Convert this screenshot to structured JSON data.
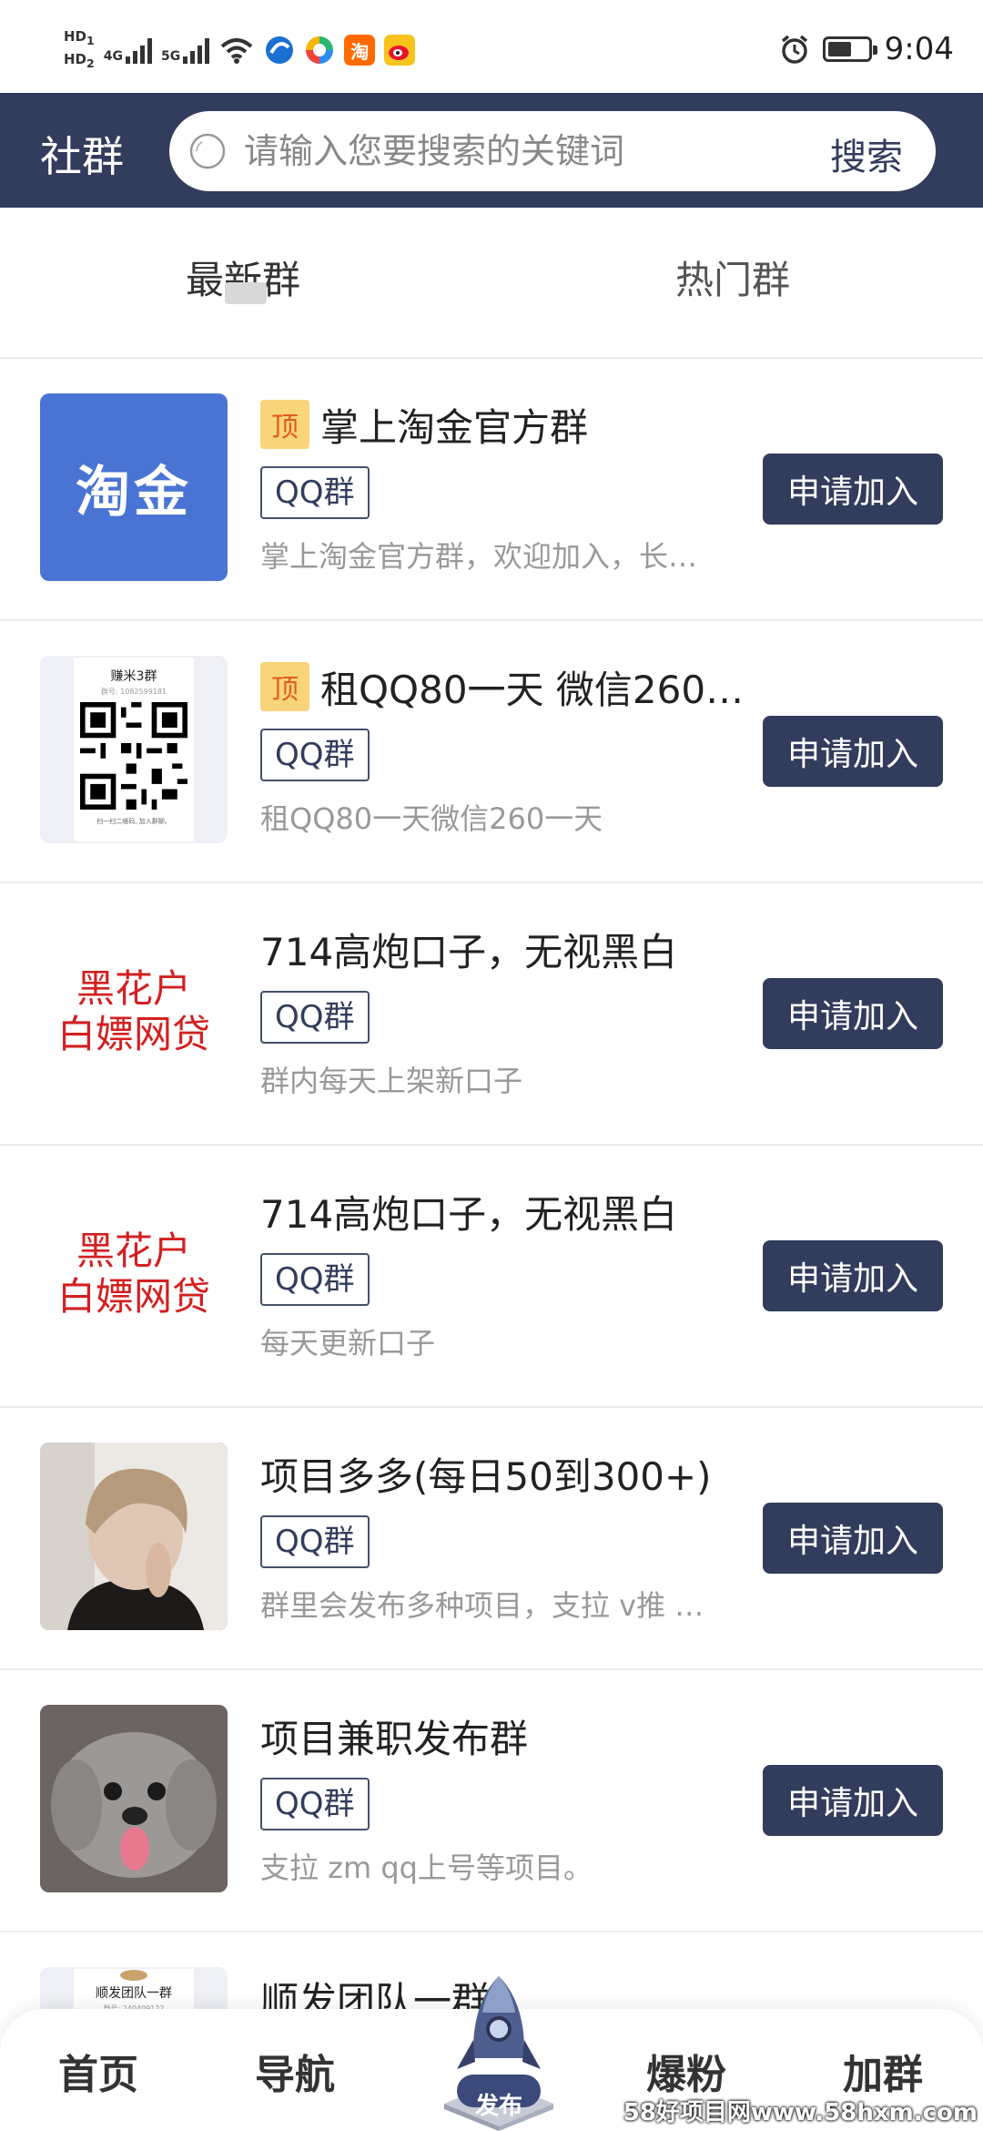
{
  "status_bar": {
    "hd1": "HD",
    "hd1_sub": "1",
    "hd2": "HD",
    "hd2_sub": "2",
    "net1": "4G",
    "net2": "5G",
    "taobao_glyph": "淘",
    "time": "9:04",
    "icons": [
      "wifi-icon",
      "browser-icon",
      "colorful-app-icon",
      "taobao-icon",
      "weibo-icon",
      "alarm-icon",
      "battery-icon"
    ]
  },
  "header": {
    "title": "社群",
    "search_placeholder": "请输入您要搜索的关键词",
    "search_button": "搜索",
    "bg_color": "#323c5c"
  },
  "tabs": [
    {
      "label": "最新群",
      "active": true
    },
    {
      "label": "热门群",
      "active": false
    }
  ],
  "thumb_text": {
    "taojin": "淘金",
    "heihuahu_1": "黑花户",
    "heihuahu_2": "白嫖网贷",
    "qr_name": "赚米3群",
    "qr_sub": "群号: 1082599181",
    "qr_foot": "扫一扫二维码, 加入群聊。",
    "shunfa_name": "顺发团队一群",
    "shunfa_sub": "群号: 240409122"
  },
  "groups": [
    {
      "pinned": true,
      "pin_label": "顶",
      "title": "掌上淘金官方群",
      "tag": "QQ群",
      "desc": "掌上淘金官方群，欢迎加入，长…",
      "button": "申请加入"
    },
    {
      "pinned": true,
      "pin_label": "顶",
      "title": "租QQ80一天 微信260…",
      "tag": "QQ群",
      "desc": "租QQ80一天微信260一天",
      "button": "申请加入"
    },
    {
      "pinned": false,
      "title": "714高炮口子，无视黑白",
      "tag": "QQ群",
      "desc": "群内每天上架新口子",
      "button": "申请加入"
    },
    {
      "pinned": false,
      "title": "714高炮口子，无视黑白",
      "tag": "QQ群",
      "desc": "每天更新口子",
      "button": "申请加入"
    },
    {
      "pinned": false,
      "title": "项目多多(每日50到300+)",
      "tag": "QQ群",
      "desc": "群里会发布多种项目，支拉 v推 …",
      "button": "申请加入"
    },
    {
      "pinned": false,
      "title": "项目兼职发布群",
      "tag": "QQ群",
      "desc": "支拉 zm qq上号等项目。",
      "button": "申请加入"
    },
    {
      "pinned": false,
      "title": "顺发团队一群",
      "tag": "",
      "desc": "",
      "button": ""
    }
  ],
  "bottom_nav": {
    "home": "首页",
    "nav": "导航",
    "publish": "发布",
    "fans": "爆粉",
    "join": "加群"
  },
  "watermark": "58好项目网www.58hxm.com",
  "colors": {
    "primary": "#323c5c",
    "pin_bg": "#f8d57a",
    "pin_text": "#e25b22",
    "red_text": "#d32020"
  }
}
